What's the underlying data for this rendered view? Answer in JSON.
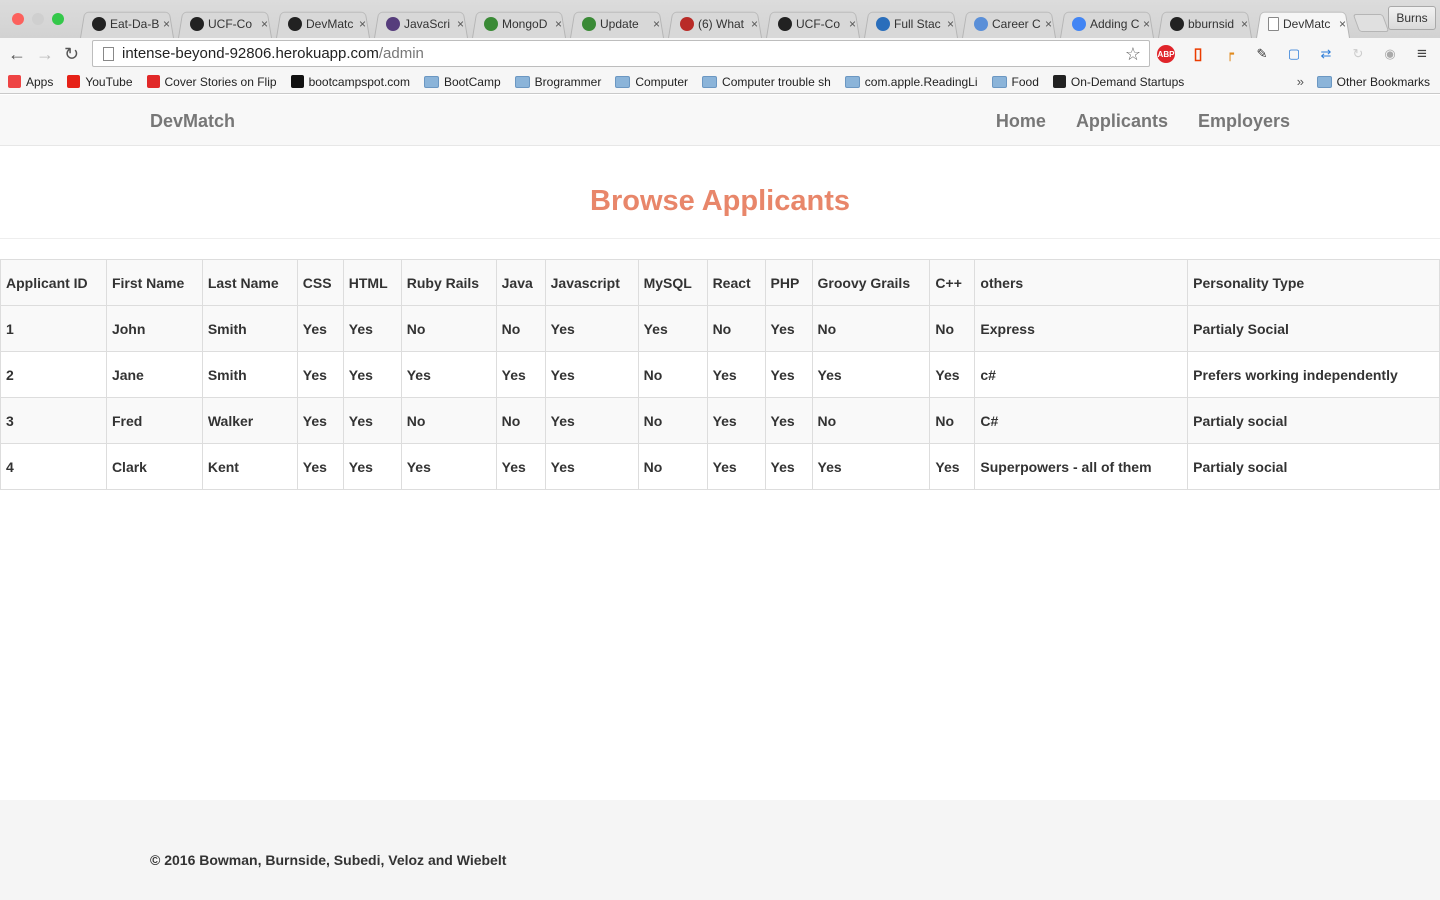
{
  "browser": {
    "tabs": [
      {
        "title": "Eat-Da-B",
        "icon": "github-icon"
      },
      {
        "title": "UCF-Co",
        "icon": "github-icon"
      },
      {
        "title": "DevMatc",
        "icon": "github-icon"
      },
      {
        "title": "JavaScri",
        "icon": "bootstrap-icon"
      },
      {
        "title": "MongoD",
        "icon": "mongodb-icon"
      },
      {
        "title": "Update",
        "icon": "mongodb-icon"
      },
      {
        "title": "(6) What",
        "icon": "quora-icon"
      },
      {
        "title": "UCF-Co",
        "icon": "github-icon"
      },
      {
        "title": "Full Stac",
        "icon": "info-icon"
      },
      {
        "title": "Career C",
        "icon": "career-icon"
      },
      {
        "title": "Adding C",
        "icon": "google-icon"
      },
      {
        "title": "bburnsid",
        "icon": "github-icon"
      },
      {
        "title": "DevMatc",
        "icon": "page-icon"
      }
    ],
    "profile": "Burns",
    "url_host": "intense-beyond-92806.herokuapp.com",
    "url_path": "/admin",
    "bookmarks": [
      {
        "label": "Apps",
        "icon": "apps-icon"
      },
      {
        "label": "YouTube",
        "icon": "youtube-icon"
      },
      {
        "label": "Cover Stories on Flip",
        "icon": "flipboard-icon"
      },
      {
        "label": "bootcampspot.com",
        "icon": "bootcamp-icon"
      },
      {
        "label": "BootCamp",
        "icon": "folder-icon"
      },
      {
        "label": "Brogrammer",
        "icon": "folder-icon"
      },
      {
        "label": "Computer",
        "icon": "folder-icon"
      },
      {
        "label": "Computer trouble sh",
        "icon": "folder-icon"
      },
      {
        "label": "com.apple.ReadingLi",
        "icon": "folder-icon"
      },
      {
        "label": "Food",
        "icon": "folder-icon"
      },
      {
        "label": "On-Demand Startups",
        "icon": "startup-icon"
      }
    ],
    "bookmarks_overflow": "»",
    "other_bookmarks": "Other Bookmarks"
  },
  "navbar": {
    "brand": "DevMatch",
    "links": [
      "Home",
      "Applicants",
      "Employers"
    ]
  },
  "page": {
    "title": "Browse Applicants",
    "title_color": "#e8866a"
  },
  "table": {
    "headers": [
      "Applicant ID",
      "First Name",
      "Last Name",
      "CSS",
      "HTML",
      "Ruby Rails",
      "Java",
      "Javascript",
      "MySQL",
      "React",
      "PHP",
      "Groovy Grails",
      "C++",
      "others",
      "Personality Type"
    ],
    "rows": [
      [
        "1",
        "John",
        "Smith",
        "Yes",
        "Yes",
        "No",
        "No",
        "Yes",
        "Yes",
        "No",
        "Yes",
        "No",
        "No",
        "Express",
        "Partialy Social"
      ],
      [
        "2",
        "Jane",
        "Smith",
        "Yes",
        "Yes",
        "Yes",
        "Yes",
        "Yes",
        "No",
        "Yes",
        "Yes",
        "Yes",
        "Yes",
        "c#",
        "Prefers working independently"
      ],
      [
        "3",
        "Fred",
        "Walker",
        "Yes",
        "Yes",
        "No",
        "No",
        "Yes",
        "No",
        "Yes",
        "Yes",
        "No",
        "No",
        "C#",
        "Partialy social"
      ],
      [
        "4",
        "Clark",
        "Kent",
        "Yes",
        "Yes",
        "Yes",
        "Yes",
        "Yes",
        "No",
        "Yes",
        "Yes",
        "Yes",
        "Yes",
        "Superpowers - all of them",
        "Partialy social"
      ]
    ]
  },
  "footer": {
    "text": "© 2016 Bowman, Burnside, Subedi, Veloz and Wiebelt"
  }
}
